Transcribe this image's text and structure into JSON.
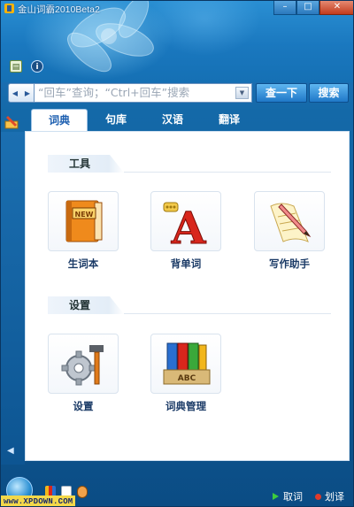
{
  "window": {
    "title": "金山词霸2010Beta2",
    "controls": [
      "–",
      "□",
      "✕"
    ]
  },
  "search": {
    "placeholder": "“回车”查询；“Ctrl+回车”搜索",
    "lookup_label": "查一下",
    "search_label": "搜索"
  },
  "tabs": [
    "词典",
    "句库",
    "汉语",
    "翻译"
  ],
  "active_tab": "词典",
  "sections": [
    {
      "label": "工具",
      "items": [
        "生词本",
        "背单词",
        "写作助手"
      ]
    },
    {
      "label": "设置",
      "items": [
        "设置",
        "词典管理"
      ]
    }
  ],
  "status": {
    "link1": "取词",
    "link2": "划译"
  },
  "watermark": "www.XPDOWN.COM",
  "colors": {
    "accent": "#1d6fb4",
    "tab_active_text": "#1d5fb0"
  }
}
